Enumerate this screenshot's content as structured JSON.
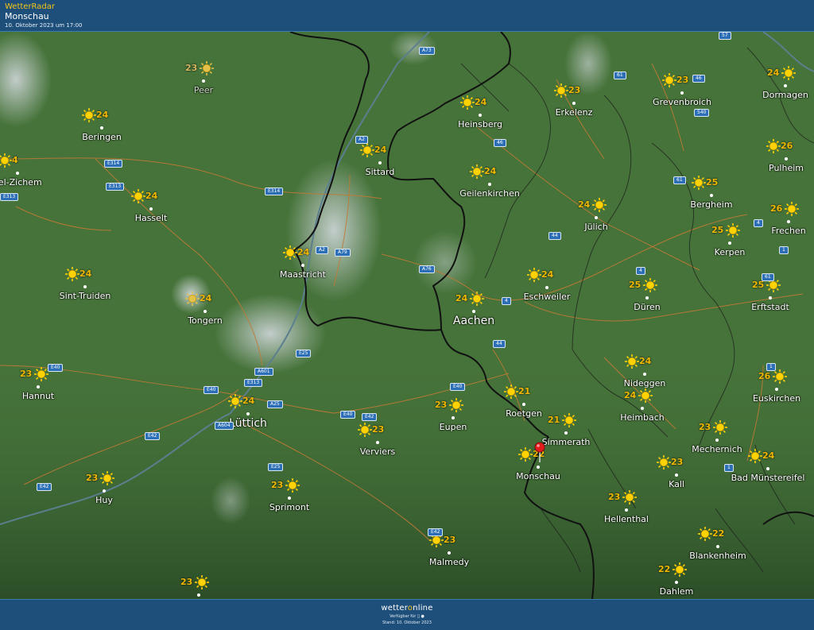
{
  "header": {
    "brand": "WetterRadar",
    "location": "Monschau",
    "timestamp": "10. Oktober 2023 um 17:00"
  },
  "footer": {
    "logo_pre": "wetter",
    "logo_o": "o",
    "logo_post": "nline",
    "available": "Verfügbar für",
    "stand": "Stand: 10. Oktober 2023"
  },
  "cities": [
    {
      "name": "Peer",
      "temp": "23",
      "tempSide": "left",
      "dim": true
    },
    {
      "name": "Beringen",
      "temp": "24",
      "tempSide": "right"
    },
    {
      "name": "vel-Zichem",
      "temp": "4",
      "tempSide": "right"
    },
    {
      "name": "Hasselt",
      "temp": "24",
      "tempSide": "right"
    },
    {
      "name": "Sint-Truiden",
      "temp": "24",
      "tempSide": "right"
    },
    {
      "name": "Tongern",
      "temp": "24",
      "tempSide": "right",
      "hazy": true
    },
    {
      "name": "Hannut",
      "temp": "23",
      "tempSide": "left"
    },
    {
      "name": "Huy",
      "temp": "23",
      "tempSide": "left"
    },
    {
      "name": "Lüttich",
      "temp": "24",
      "tempSide": "right",
      "big": true
    },
    {
      "name": "Sprimont",
      "temp": "23",
      "tempSide": "left"
    },
    {
      "name": "Maastricht",
      "temp": "24",
      "tempSide": "right"
    },
    {
      "name": "Sittard",
      "temp": "24",
      "tempSide": "right"
    },
    {
      "name": "Heinsberg",
      "temp": "24",
      "tempSide": "right"
    },
    {
      "name": "Geilenkirchen",
      "temp": "24",
      "tempSide": "right"
    },
    {
      "name": "Erkelenz",
      "temp": "23",
      "tempSide": "right"
    },
    {
      "name": "Grevenbroich",
      "temp": "23",
      "tempSide": "right"
    },
    {
      "name": "Dormagen",
      "temp": "24",
      "tempSide": "left"
    },
    {
      "name": "Pulheim",
      "temp": "26",
      "tempSide": "right"
    },
    {
      "name": "Bergheim",
      "temp": "25",
      "tempSide": "right"
    },
    {
      "name": "Frechen",
      "temp": "26",
      "tempSide": "left"
    },
    {
      "name": "Kerpen",
      "temp": "25",
      "tempSide": "left"
    },
    {
      "name": "Jülich",
      "temp": "24",
      "tempSide": "left"
    },
    {
      "name": "Eschweiler",
      "temp": "24",
      "tempSide": "right"
    },
    {
      "name": "Aachen",
      "temp": "24",
      "tempSide": "left",
      "big": true
    },
    {
      "name": "Düren",
      "temp": "25",
      "tempSide": "left"
    },
    {
      "name": "Erftstadt",
      "temp": "25",
      "tempSide": "left"
    },
    {
      "name": "Verviers",
      "temp": "23",
      "tempSide": "right"
    },
    {
      "name": "Eupen",
      "temp": "23",
      "tempSide": "left"
    },
    {
      "name": "Roetgen",
      "temp": "21",
      "tempSide": "right"
    },
    {
      "name": "Simmerath",
      "temp": "21",
      "tempSide": "left"
    },
    {
      "name": "Monschau",
      "temp": "22",
      "tempSide": "right"
    },
    {
      "name": "Nideggen",
      "temp": "24",
      "tempSide": "right"
    },
    {
      "name": "Heimbach",
      "temp": "24",
      "tempSide": "left"
    },
    {
      "name": "Euskirchen",
      "temp": "26",
      "tempSide": "left"
    },
    {
      "name": "Mechernich",
      "temp": "23",
      "tempSide": "left"
    },
    {
      "name": "Kall",
      "temp": "23",
      "tempSide": "right"
    },
    {
      "name": "Bad Münstereifel",
      "temp": "24",
      "tempSide": "right"
    },
    {
      "name": "Hellenthal",
      "temp": "23",
      "tempSide": "left"
    },
    {
      "name": "Malmedy",
      "temp": "23",
      "tempSide": "right"
    },
    {
      "name": "Blankenheim",
      "temp": "22",
      "tempSide": "right"
    },
    {
      "name": "Dahlem",
      "temp": "22",
      "tempSide": "left"
    },
    {
      "name": "",
      "temp": "23",
      "tempSide": "left"
    }
  ],
  "roads": [
    "A73",
    "A2",
    "E314",
    "E313",
    "E314",
    "E313",
    "A2",
    "A79",
    "A76",
    "E25",
    "A601",
    "E313",
    "E40",
    "E40",
    "A25",
    "A604",
    "E42",
    "E42",
    "E42",
    "E40",
    "E25",
    "E42",
    "E40",
    "57",
    "61",
    "46",
    "540",
    "46",
    "61",
    "44",
    "4",
    "4",
    "1",
    "61",
    "4",
    "44",
    "1",
    "1"
  ],
  "colors": {
    "header": "#1e4f7a",
    "temp": "#f1b800",
    "sun": "#ffd200",
    "road_sign": "#2d6fb6",
    "land": "#3f6a35"
  }
}
